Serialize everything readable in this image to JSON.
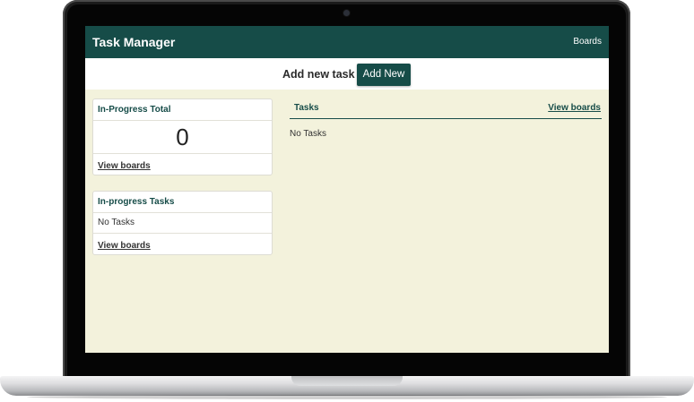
{
  "app": {
    "title": "Task Manager",
    "nav_boards": "Boards"
  },
  "action_bar": {
    "label": "Add new task",
    "button": "Add New"
  },
  "in_progress_total": {
    "title": "In-Progress Total",
    "count": "0",
    "link": "View boards"
  },
  "in_progress_tasks": {
    "title": "In-progress Tasks",
    "empty": "No Tasks",
    "link": "View boards"
  },
  "tasks_panel": {
    "title": "Tasks",
    "link": "View boards",
    "empty": "No Tasks"
  },
  "colors": {
    "primary": "#164c48",
    "page_background": "#f3f2dc"
  }
}
